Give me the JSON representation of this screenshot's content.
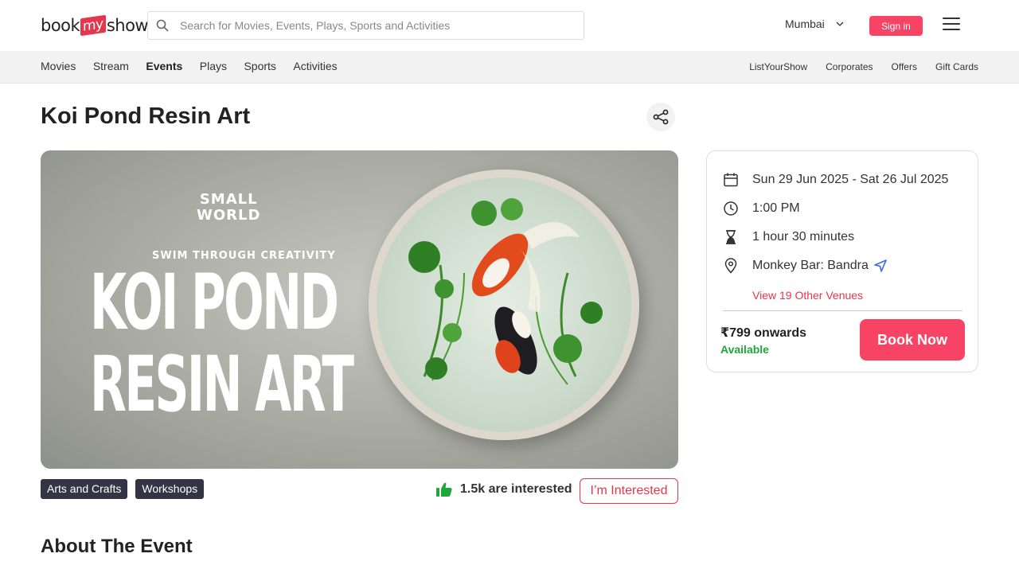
{
  "header": {
    "logo_left": "book",
    "logo_mid": "my",
    "logo_right": "show",
    "search_placeholder": "Search for Movies, Events, Plays, Sports and Activities",
    "city": "Mumbai",
    "signin_label": "Sign in"
  },
  "nav": {
    "left": [
      "Movies",
      "Stream",
      "Events",
      "Plays",
      "Sports",
      "Activities"
    ],
    "active": "Events",
    "right": [
      "ListYourShow",
      "Corporates",
      "Offers",
      "Gift Cards"
    ]
  },
  "event": {
    "title": "Koi Pond Resin Art",
    "banner": {
      "brand_line1": "SMALL",
      "brand_line2": "WORLD",
      "tagline": "SWIM THROUGH CREATIVITY",
      "big_line1": "KOI POND",
      "big_line2": "RESIN ART"
    },
    "tags": [
      "Arts and Crafts",
      "Workshops"
    ],
    "interested_text": "1.5k are interested",
    "interested_button": "I’m Interested",
    "about_heading": "About The Event"
  },
  "card": {
    "dates": "Sun 29 Jun 2025 - Sat 26 Jul 2025",
    "time": "1:00 PM",
    "duration": "1 hour 30 minutes",
    "venue": "Monkey Bar: Bandra",
    "other_venues": "View 19 Other Venues",
    "price": "₹799 onwards",
    "availability": "Available",
    "book_label": "Book Now"
  },
  "colors": {
    "brand_red": "#f84464",
    "accent_red": "#e5364b",
    "tag_bg": "#333545",
    "available_green": "#1ea83c"
  }
}
